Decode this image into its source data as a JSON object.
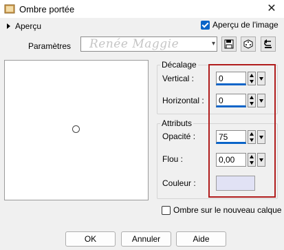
{
  "window": {
    "title": "Ombre portée",
    "close_glyph": "✕"
  },
  "apercu": {
    "label": "Aperçu"
  },
  "image_preview": {
    "label": "Aperçu de l'image",
    "checked": true
  },
  "preset": {
    "label": "Paramètres",
    "value": "",
    "watermark": "Renée Maggie"
  },
  "decalage": {
    "title": "Décalage",
    "vertical_label": "Vertical :",
    "vertical_value": "0",
    "horizontal_label": "Horizontal :",
    "horizontal_value": "0"
  },
  "attributs": {
    "title": "Attributs",
    "opacity_label": "Opacité :",
    "opacity_value": "75",
    "blur_label": "Flou :",
    "blur_value": "0,00",
    "color_label": "Couleur :",
    "color_hex": "#e1e2f5"
  },
  "shadow_layer": {
    "label": "Ombre sur le nouveau calque",
    "checked": false
  },
  "buttons": {
    "ok": "OK",
    "cancel": "Annuler",
    "help": "Aide"
  },
  "colors": {
    "accent": "#0a64c8",
    "highlight": "#b01c1c"
  }
}
